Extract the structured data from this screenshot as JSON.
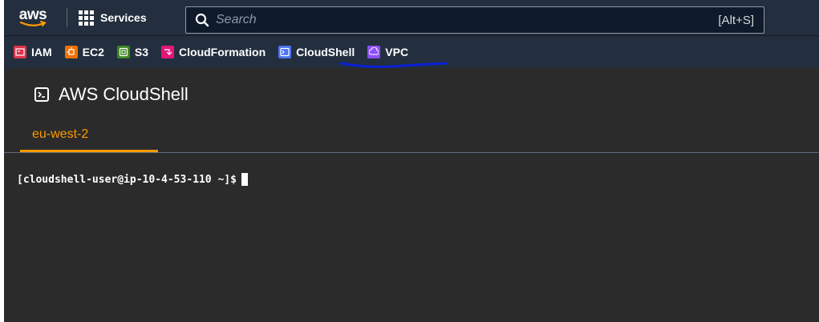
{
  "nav": {
    "logo_text": "aws",
    "services_label": "Services",
    "search_placeholder": "Search",
    "search_shortcut": "[Alt+S]"
  },
  "favorites": [
    {
      "label": "IAM",
      "color": "#dd344c",
      "icon": "iam-icon"
    },
    {
      "label": "EC2",
      "color": "#ed7100",
      "icon": "ec2-icon"
    },
    {
      "label": "S3",
      "color": "#3f8624",
      "icon": "s3-icon"
    },
    {
      "label": "CloudFormation",
      "color": "#e7157b",
      "icon": "cloudformation-icon"
    },
    {
      "label": "CloudShell",
      "color": "#4d72f3",
      "icon": "cloudshell-icon"
    },
    {
      "label": "VPC",
      "color": "#8c4fff",
      "icon": "vpc-icon"
    }
  ],
  "page": {
    "title": "AWS CloudShell",
    "tab_label": "eu-west-2"
  },
  "terminal": {
    "prompt": "[cloudshell-user@ip-10-4-53-110 ~]$"
  },
  "colors": {
    "nav_bg": "#232f3e",
    "content_bg": "#2b2b2b",
    "accent": "#ff9900",
    "annotation": "#0a21d6"
  }
}
